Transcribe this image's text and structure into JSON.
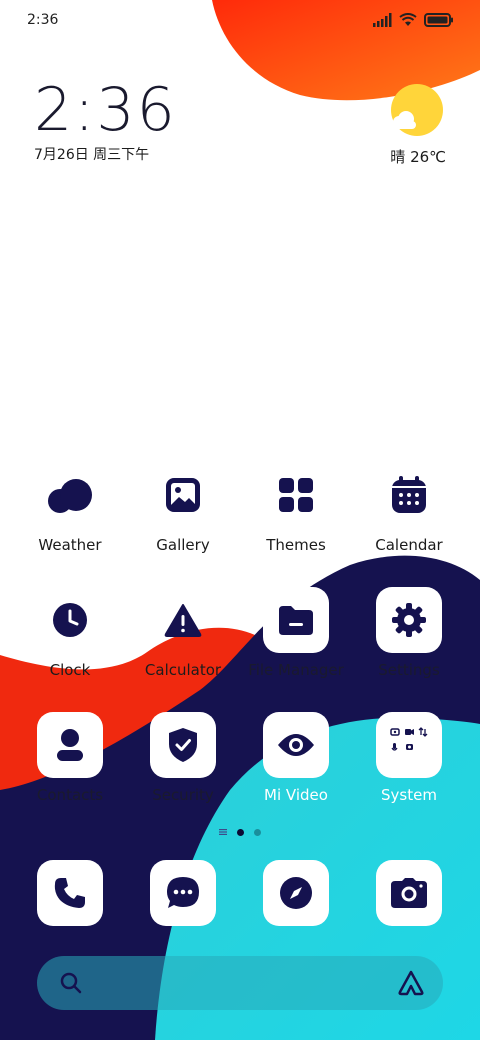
{
  "status_bar": {
    "time": "2:36",
    "icons": [
      "signal-icon",
      "wifi-icon",
      "battery-icon"
    ]
  },
  "clock_widget": {
    "time": "2:36",
    "date": "7月26日 周三下午"
  },
  "weather_widget": {
    "icon": "partly-sunny-icon",
    "text": "晴 26℃"
  },
  "apps": [
    {
      "label": "Weather",
      "icon": "weather-cloud-icon"
    },
    {
      "label": "Gallery",
      "icon": "gallery-icon"
    },
    {
      "label": "Themes",
      "icon": "themes-icon"
    },
    {
      "label": "Calendar",
      "icon": "calendar-icon"
    },
    {
      "label": "Clock",
      "icon": "clock-icon"
    },
    {
      "label": "Calculator",
      "icon": "calculator-icon"
    },
    {
      "label": "File Manager",
      "icon": "folder-icon"
    },
    {
      "label": "Settings",
      "icon": "gear-icon"
    },
    {
      "label": "Contacts",
      "icon": "person-icon"
    },
    {
      "label": "Security",
      "icon": "shield-icon"
    },
    {
      "label": "Mi Video",
      "icon": "eye-icon"
    },
    {
      "label": "System",
      "icon": "system-folder-icon"
    }
  ],
  "dock": [
    {
      "icon": "phone-icon"
    },
    {
      "icon": "messages-icon"
    },
    {
      "icon": "compass-icon"
    },
    {
      "icon": "camera-icon"
    }
  ],
  "page_indicator": {
    "pages": 2,
    "current": 1
  },
  "colors": {
    "navy": "#15124f",
    "red": "#f0290f",
    "orange": "#ff6a14",
    "cyan": "#22cfe0",
    "sun": "#ffd53a"
  }
}
